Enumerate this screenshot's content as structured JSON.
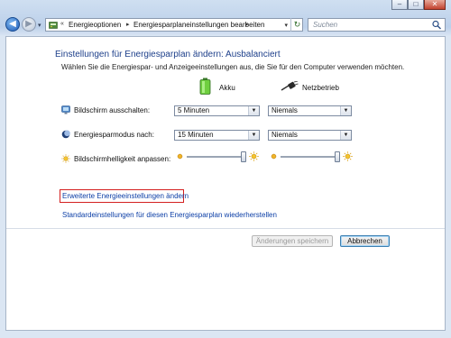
{
  "window": {
    "controls": [
      "–",
      "□",
      "✕"
    ]
  },
  "nav": {
    "back_icon": "back-arrow-icon",
    "forward_icon": "forward-arrow-icon",
    "history_symbol": "▾"
  },
  "address": {
    "prefix": "«",
    "crumbs": [
      "Energieoptionen",
      "Energiesparplaneinstellungen bearbeiten"
    ],
    "sep": "▸",
    "dropdown": "▾",
    "refresh": "↻"
  },
  "search": {
    "placeholder": "Suchen"
  },
  "main": {
    "heading": "Einstellungen für Energiesparplan ändern: Ausbalanciert",
    "description": "Wählen Sie die Energiespar- und Anzeigeeinstellungen aus, die Sie für den Computer verwenden möchten.",
    "columns": {
      "battery": "Akku",
      "plugged": "Netzbetrieb"
    },
    "rows": [
      {
        "label": "Bildschirm ausschalten:",
        "battery_value": "5 Minuten",
        "plugged_value": "Niemals"
      },
      {
        "label": "Energiesparmodus nach:",
        "battery_value": "15 Minuten",
        "plugged_value": "Niemals"
      }
    ],
    "brightness": {
      "label": "Bildschirmhelligkeit anpassen:",
      "battery_level": 1.0,
      "plugged_level": 1.0
    },
    "links": {
      "advanced": "Erweiterte Energieeinstellungen ändern",
      "restore": "Standardeinstellungen für diesen Energiesparplan wiederherstellen"
    },
    "buttons": {
      "save": "Änderungen speichern",
      "cancel": "Abbrechen"
    }
  },
  "colors": {
    "heading": "#1d3f8a",
    "link": "#0b3ea6",
    "highlight_box": "#d42020"
  }
}
